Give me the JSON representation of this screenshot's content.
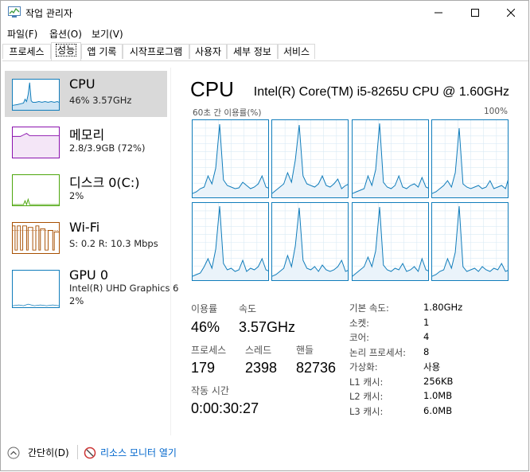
{
  "window": {
    "title": "작업 관리자"
  },
  "menu": {
    "items": [
      "파일(F)",
      "옵션(O)",
      "보기(V)"
    ]
  },
  "tabs": [
    "프로세스",
    "성능",
    "앱 기록",
    "시작프로그램",
    "사용자",
    "세부 정보",
    "서비스"
  ],
  "active_tab": "성능",
  "sidebar": {
    "items": [
      {
        "title": "CPU",
        "sub1": "46% 3.57GHz",
        "icon": "cpu-graph-icon",
        "color": "#117dbb"
      },
      {
        "title": "메모리",
        "sub1": "2.8/3.9GB (72%)",
        "icon": "memory-graph-icon",
        "color": "#8b12ae"
      },
      {
        "title": "디스크 0(C:)",
        "sub1": "2%",
        "icon": "disk-graph-icon",
        "color": "#4da60c"
      },
      {
        "title": "Wi-Fi",
        "sub1": "S: 0.2  R: 10.3 Mbps",
        "icon": "wifi-graph-icon",
        "color": "#a74f01"
      },
      {
        "title": "GPU 0",
        "sub1": "Intel(R) UHD Graphics 6",
        "sub2": "2%",
        "icon": "gpu-graph-icon",
        "color": "#117dbb"
      }
    ]
  },
  "main": {
    "title": "CPU",
    "model": "Intel(R) Core(TM) i5-8265U CPU @ 1.60GHz",
    "graph_left_label": "60초 간 이용률(%)",
    "graph_right_label": "100%",
    "stats": {
      "usage_label": "이용률",
      "usage": "46%",
      "speed_label": "속도",
      "speed": "3.57GHz",
      "processes_label": "프로세스",
      "processes": "179",
      "threads_label": "스레드",
      "threads": "2398",
      "handles_label": "핸들",
      "handles": "82736",
      "uptime_label": "작동 시간",
      "uptime": "0:00:30:27"
    },
    "specs": [
      {
        "label": "기본 속도:",
        "value": "1.80GHz"
      },
      {
        "label": "소켓:",
        "value": "1"
      },
      {
        "label": "코어:",
        "value": "4"
      },
      {
        "label": "논리 프로세서:",
        "value": "8"
      },
      {
        "label": "가상화:",
        "value": "사용"
      },
      {
        "label": "L1 캐시:",
        "value": "256KB"
      },
      {
        "label": "L2 캐시:",
        "value": "1.0MB"
      },
      {
        "label": "L3 캐시:",
        "value": "6.0MB"
      }
    ]
  },
  "footer": {
    "collapse": "간단히(D)",
    "resource_monitor": "리소스 모니터 열기"
  },
  "colors": {
    "accent": "#117dbb",
    "link": "#0066cc",
    "sidebar_active": "#d9d9d9"
  }
}
